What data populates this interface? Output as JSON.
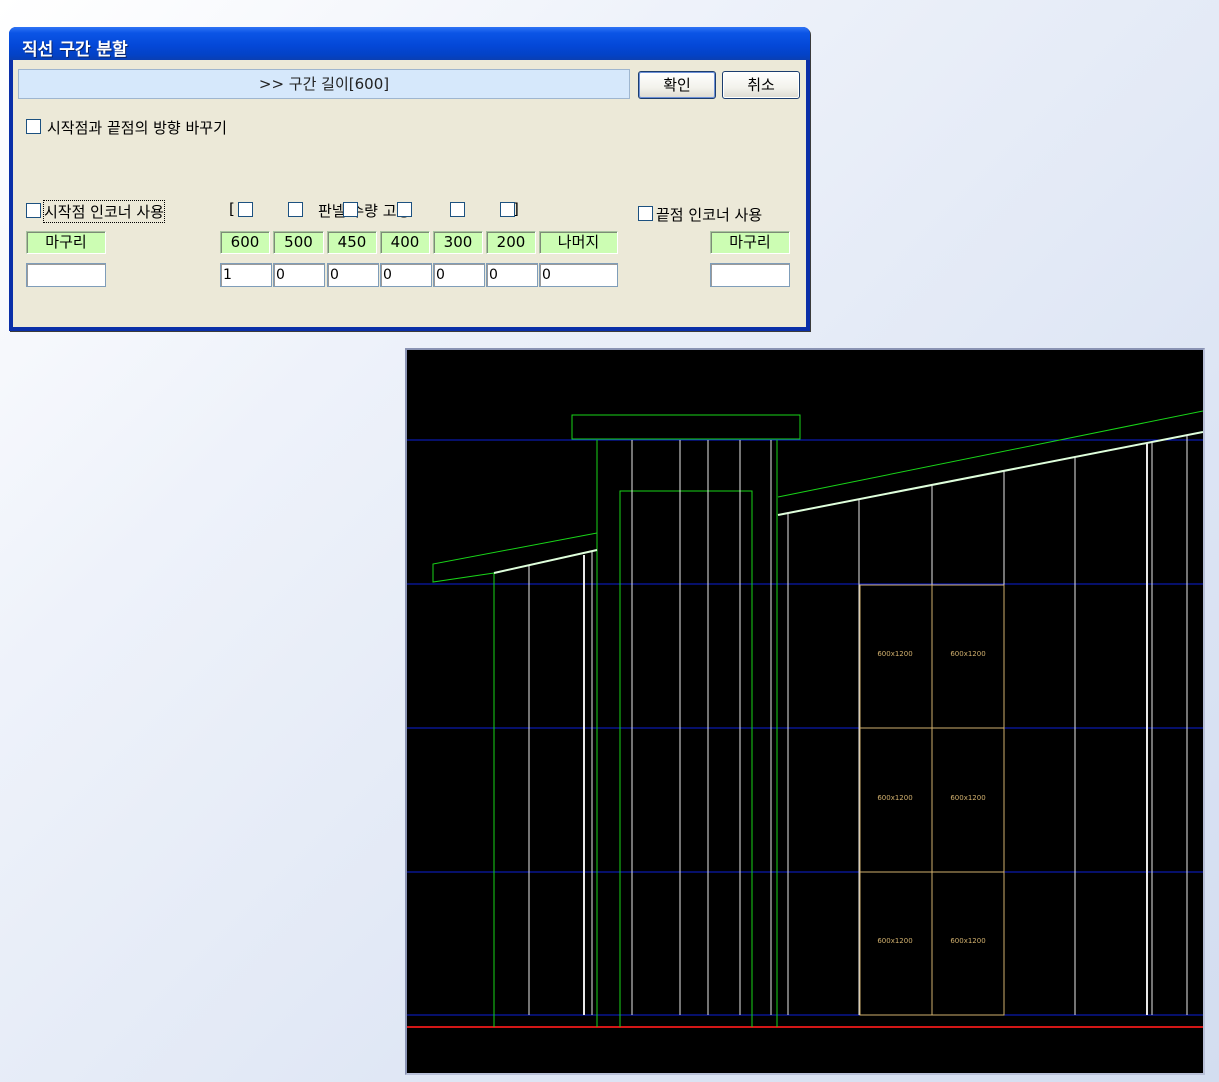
{
  "dialog": {
    "title": "직선 구간 분할",
    "command_line": ">> 구간 길이[600]",
    "ok_label": "확인",
    "cancel_label": "취소",
    "reverse_direction_label": "시작점과 끝점의 방향 바꾸기",
    "panel_qty_bracket_left": "[",
    "panel_qty_label": "판넬 수량 고정",
    "panel_qty_bracket_right": "]",
    "start_corner_label": "시작점 인코너 사용",
    "end_corner_label": "끝점 인코너 사용",
    "start_finish_label": "마구리",
    "end_finish_label": "마구리",
    "start_finish_value": "",
    "end_finish_value": "",
    "size_columns": [
      {
        "label": "600",
        "value": "1"
      },
      {
        "label": "500",
        "value": "0"
      },
      {
        "label": "450",
        "value": "0"
      },
      {
        "label": "400",
        "value": "0"
      },
      {
        "label": "300",
        "value": "0"
      },
      {
        "label": "200",
        "value": "0"
      },
      {
        "label": "나머지",
        "value": "0"
      }
    ],
    "checkbox_states": {
      "reverse_direction": false,
      "start_corner": false,
      "end_corner": false,
      "fix_600": false,
      "fix_500": false,
      "fix_450": false,
      "fix_400": false,
      "fix_300": false,
      "fix_200": false
    }
  },
  "cad_view": {
    "panel_labels": [
      "600x1200",
      "600x1200",
      "600x1200",
      "600x1200",
      "600x1200",
      "600x1200"
    ],
    "colors": {
      "background": "#000000",
      "grid": "#0b1fd6",
      "outline": "#19d419",
      "panel": "#e8e8e8",
      "tile": "#d1b06e",
      "ground": "#d21616"
    }
  }
}
